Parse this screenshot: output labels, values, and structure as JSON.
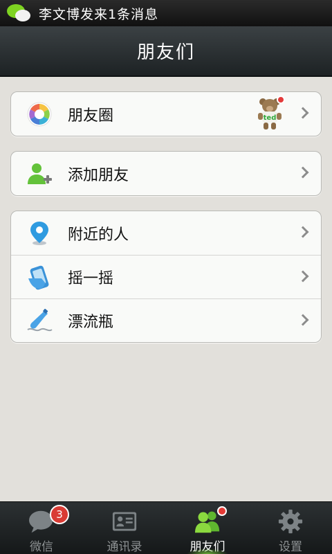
{
  "status_bar": {
    "notification": "李文博发来1条消息"
  },
  "header": {
    "title": "朋友们"
  },
  "groups": [
    {
      "items": [
        {
          "label": "朋友圈",
          "icon": "moments-icon",
          "has_new_dot": true
        }
      ]
    },
    {
      "items": [
        {
          "label": "添加朋友",
          "icon": "add-friend-icon"
        }
      ]
    },
    {
      "items": [
        {
          "label": "附近的人",
          "icon": "location-pin-icon"
        },
        {
          "label": "摇一摇",
          "icon": "shake-phone-icon"
        },
        {
          "label": "漂流瓶",
          "icon": "drift-bottle-icon"
        }
      ]
    }
  ],
  "moments_thumbnail": {
    "text": "ted"
  },
  "tab_bar": {
    "tabs": [
      {
        "label": "微信",
        "icon": "chat-bubble-icon",
        "badge": "3"
      },
      {
        "label": "通讯录",
        "icon": "contacts-card-icon"
      },
      {
        "label": "朋友们",
        "icon": "friends-icon",
        "active": true,
        "has_dot": true
      },
      {
        "label": "设置",
        "icon": "gear-icon"
      }
    ]
  },
  "colors": {
    "accent_green": "#7ed321",
    "badge_red": "#d93b34",
    "background": "#e2e0db"
  }
}
